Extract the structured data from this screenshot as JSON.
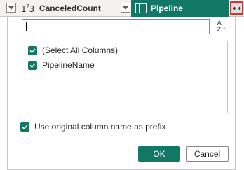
{
  "header": {
    "left_column_type": "123",
    "left_column_name": "CanceledCount",
    "right_column_name": "Pipeline",
    "expand_icon": "expand-columns-icon",
    "table_icon": "table-icon"
  },
  "dialog": {
    "search": {
      "value": "",
      "placeholder": ""
    },
    "sort_icon": "sort-az-icon",
    "sort_label_top": "A",
    "sort_label_bottom": "Z",
    "columns": [
      {
        "label": "(Select All Columns)",
        "checked": true
      },
      {
        "label": "PipelineName",
        "checked": true
      }
    ],
    "prefix_label": "Use original column name as prefix",
    "prefix_checked": true,
    "ok_label": "OK",
    "cancel_label": "Cancel"
  },
  "colors": {
    "accent": "#117865",
    "highlight_border": "#d13438"
  }
}
